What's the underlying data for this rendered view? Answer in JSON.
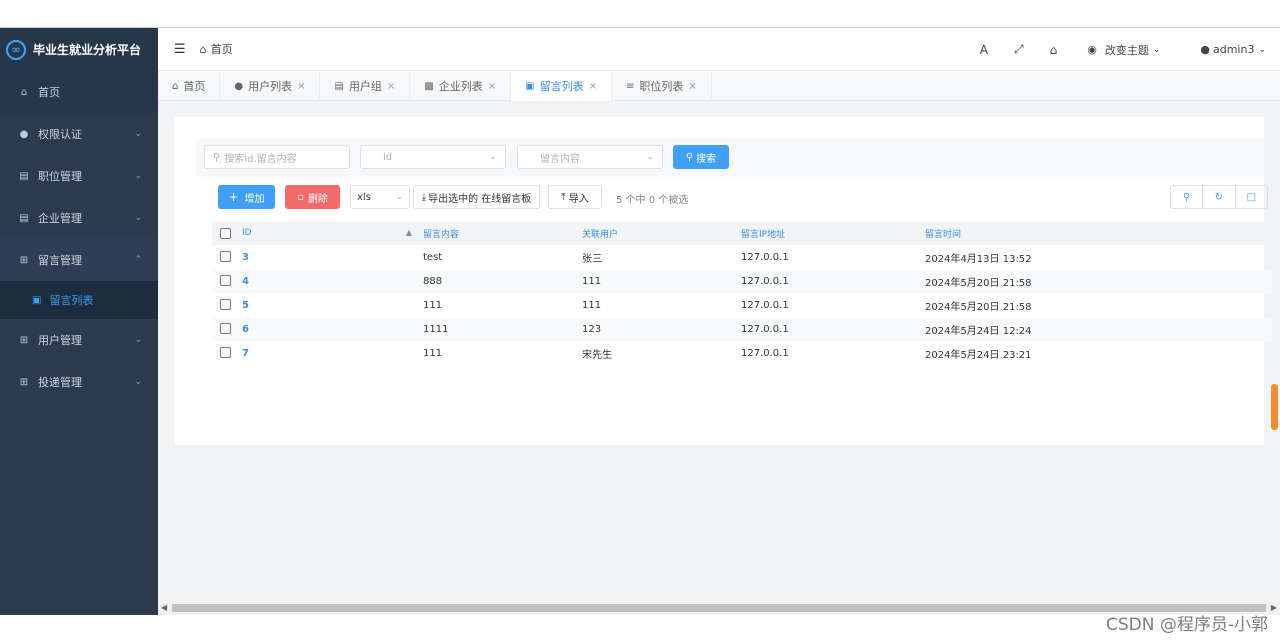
{
  "app": {
    "title": "毕业生就业分析平台",
    "logo_glyph": "∞"
  },
  "sidebar": {
    "items": [
      {
        "label": "首页",
        "icon": "home-icon"
      },
      {
        "label": "权限认证",
        "icon": "user-key-icon"
      },
      {
        "label": "职位管理",
        "icon": "card-icon"
      },
      {
        "label": "企业管理",
        "icon": "list-icon"
      },
      {
        "label": "留言管理",
        "icon": "grid-icon"
      },
      {
        "label": "用户管理",
        "icon": "grid-icon"
      },
      {
        "label": "投递管理",
        "icon": "grid-icon"
      }
    ],
    "subitem": {
      "label": "留言列表",
      "icon": "image-icon"
    }
  },
  "header": {
    "breadcrumb": "首页",
    "theme_label": "改变主题",
    "user_label": "admin3"
  },
  "tabs": [
    {
      "label": "首页",
      "icon": "home-icon",
      "closable": false
    },
    {
      "label": "用户列表",
      "icon": "user-icon",
      "closable": true
    },
    {
      "label": "用户组",
      "icon": "table-icon",
      "closable": true
    },
    {
      "label": "企业列表",
      "icon": "chart-icon",
      "closable": true
    },
    {
      "label": "留言列表",
      "icon": "image-icon",
      "closable": true,
      "active": true
    },
    {
      "label": "职位列表",
      "icon": "list-icon",
      "closable": true
    }
  ],
  "search": {
    "keyword_placeholder": "搜索id,留言内容",
    "field_select_placeholder": "id",
    "content_select_placeholder": "留言内容",
    "search_button": "搜索"
  },
  "toolbar": {
    "add_label": "增加",
    "delete_label": "删除",
    "format_value": "xls",
    "export_label": "导出选中的 在线留言板",
    "import_label": "导入",
    "selection_info": "5 个中 0 个被选"
  },
  "table": {
    "columns": [
      "ID",
      "留言内容",
      "关联用户",
      "留言IP地址",
      "留言时间"
    ],
    "rows": [
      {
        "id": "3",
        "content": "test",
        "user": "张三",
        "ip": "127.0.0.1",
        "time": "2024年4月13日 13:52"
      },
      {
        "id": "4",
        "content": "888",
        "user": "111",
        "ip": "127.0.0.1",
        "time": "2024年5月20日 21:58"
      },
      {
        "id": "5",
        "content": "111",
        "user": "111",
        "ip": "127.0.0.1",
        "time": "2024年5月20日 21:58"
      },
      {
        "id": "6",
        "content": "1111",
        "user": "123",
        "ip": "127.0.0.1",
        "time": "2024年5月24日 12:24"
      },
      {
        "id": "7",
        "content": "111",
        "user": "宋先生",
        "ip": "127.0.0.1",
        "time": "2024年5月24日 23:21"
      }
    ]
  },
  "watermark": "CSDN @程序员-小郭",
  "colors": {
    "sidebar": "#2c3a4e",
    "accent": "#3fa0f5",
    "danger": "#f26a6a"
  }
}
